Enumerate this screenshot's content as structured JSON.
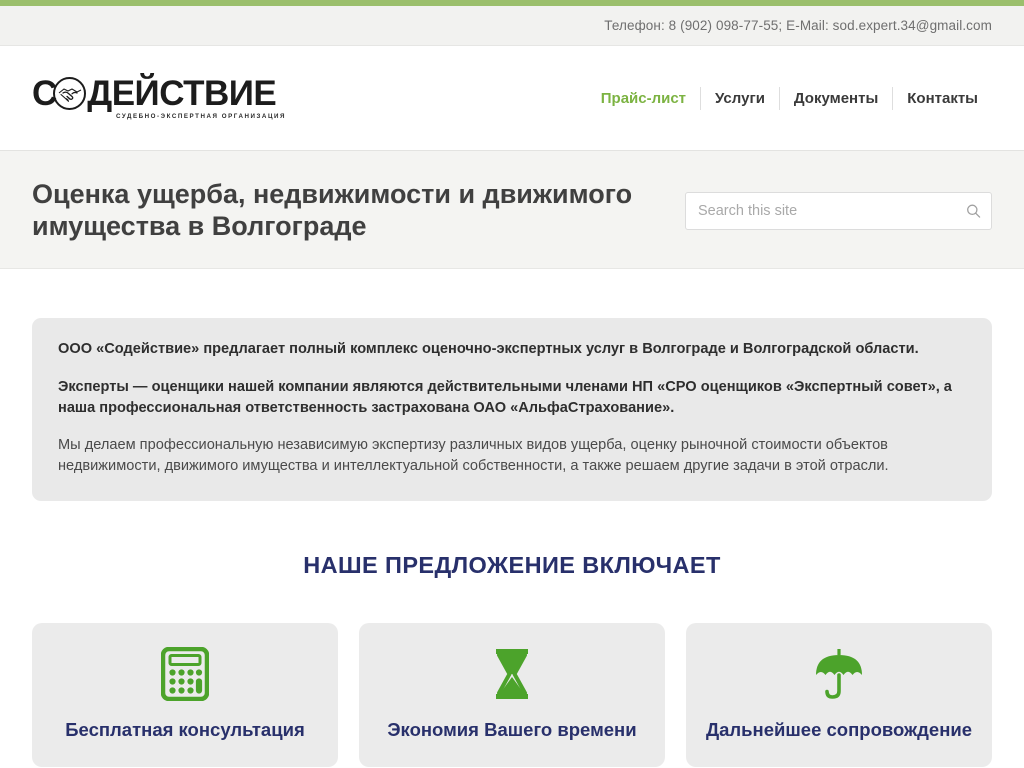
{
  "topbar": {
    "contact": "Телефон: 8 (902) 098-77-55; E-Mail: sod.expert.34@gmail.com"
  },
  "header": {
    "logo": {
      "letter_before": "С",
      "letters_after": "ДЕЙСТВИЕ",
      "subtitle": "СУДЕБНО-ЭКСПЕРТНАЯ ОРГАНИЗАЦИЯ",
      "emblem": "handshake-icon"
    },
    "nav": [
      {
        "label": "Прайс-лист",
        "active": true
      },
      {
        "label": "Услуги",
        "active": false
      },
      {
        "label": "Документы",
        "active": false
      },
      {
        "label": "Контакты",
        "active": false
      }
    ]
  },
  "title_band": {
    "page_title": "Оценка ущерба, недвижимости и движимого имущества в Волгограде",
    "search": {
      "placeholder": "Search this site",
      "value": "",
      "icon": "search-icon"
    }
  },
  "main": {
    "intro_paragraphs": [
      {
        "text": "ООО «Содействие» предлагает полный комплекс оценочно-экспертных услуг в Волгограде и Волгоградской области.",
        "bold": true
      },
      {
        "text": "Эксперты — оценщики нашей компании являются действительными членами НП «СРО оценщиков «Экспертный совет», а наша профессиональная ответственность застрахована ОАО «АльфаСтрахование».",
        "bold": true
      },
      {
        "text": "Мы делаем профессиональную независимую экспертизу различных видов ущерба, оценку рыночной стоимости объектов недвижимости, движимого имущества и интеллектуальной собственности, а также решаем другие задачи в этой отрасли.",
        "bold": false
      }
    ],
    "section_heading": "НАШЕ ПРЕДЛОЖЕНИЕ ВКЛЮЧАЕТ",
    "cards": [
      {
        "title": "Бесплатная консультация",
        "icon": "calculator-icon"
      },
      {
        "title": "Экономия Вашего времени",
        "icon": "hourglass-icon"
      },
      {
        "title": "Дальнейшее сопровождение",
        "icon": "umbrella-icon"
      }
    ]
  },
  "colors": {
    "accent_green": "#7cb342",
    "strip_green": "#9bbf6c",
    "icon_green": "#4ca32b",
    "heading_navy": "#28306b",
    "band_gray": "#f4f4f2",
    "box_gray": "#e9e9e9"
  }
}
